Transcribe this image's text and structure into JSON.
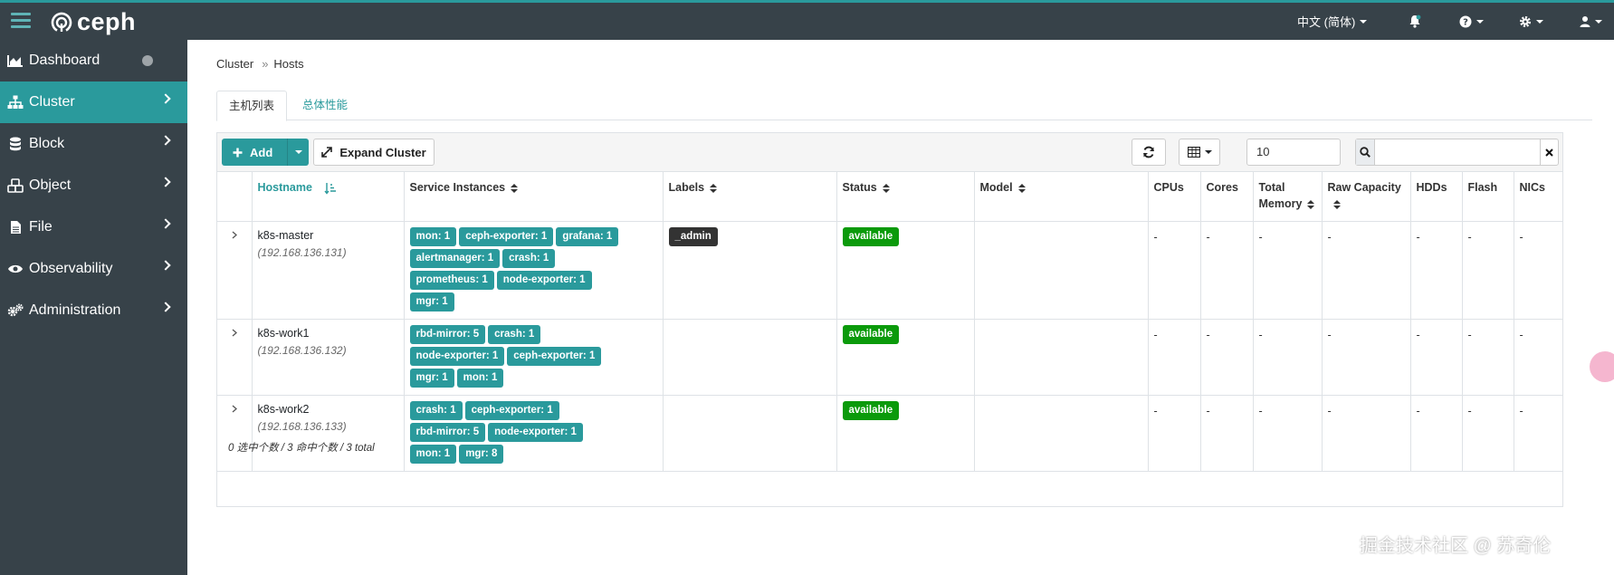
{
  "app": {
    "logo_text": "ceph"
  },
  "topbar": {
    "language": "中文 (简体)"
  },
  "sidebar": {
    "items": [
      {
        "label": "Dashboard"
      },
      {
        "label": "Cluster"
      },
      {
        "label": "Block"
      },
      {
        "label": "Object"
      },
      {
        "label": "File"
      },
      {
        "label": "Observability"
      },
      {
        "label": "Administration"
      }
    ]
  },
  "breadcrumb": {
    "parent": "Cluster",
    "current": "Hosts"
  },
  "tabs": [
    {
      "label": "主机列表"
    },
    {
      "label": "总体性能"
    }
  ],
  "toolbar": {
    "add_label": "Add",
    "expand_label": "Expand Cluster",
    "page_size": "10",
    "search_value": ""
  },
  "table": {
    "columns": [
      "Hostname",
      "Service Instances",
      "Labels",
      "Status",
      "Model",
      "CPUs",
      "Cores",
      "Total Memory",
      "Raw Capacity",
      "HDDs",
      "Flash",
      "NICs"
    ],
    "rows": [
      {
        "hostname": "k8s-master",
        "ip": "(192.168.136.131)",
        "services": [
          "mon: 1",
          "ceph-exporter: 1",
          "grafana: 1",
          "alertmanager: 1",
          "crash: 1",
          "prometheus: 1",
          "node-exporter: 1",
          "mgr: 1"
        ],
        "labels": [
          "_admin"
        ],
        "status": "available",
        "model": "",
        "cpus": "-",
        "cores": "-",
        "memory": "-",
        "raw": "-",
        "hdds": "-",
        "flash": "-",
        "nics": "-"
      },
      {
        "hostname": "k8s-work1",
        "ip": "(192.168.136.132)",
        "services": [
          "rbd-mirror: 5",
          "crash: 1",
          "node-exporter: 1",
          "ceph-exporter: 1",
          "mgr: 1",
          "mon: 1"
        ],
        "labels": [],
        "status": "available",
        "model": "",
        "cpus": "-",
        "cores": "-",
        "memory": "-",
        "raw": "-",
        "hdds": "-",
        "flash": "-",
        "nics": "-"
      },
      {
        "hostname": "k8s-work2",
        "ip": "(192.168.136.133)",
        "services": [
          "crash: 1",
          "ceph-exporter: 1",
          "rbd-mirror: 5",
          "node-exporter: 1",
          "mon: 1",
          "mgr: 8"
        ],
        "labels": [],
        "status": "available",
        "model": "",
        "cpus": "-",
        "cores": "-",
        "memory": "-",
        "raw": "-",
        "hdds": "-",
        "flash": "-",
        "nics": "-"
      }
    ]
  },
  "footer": {
    "summary": "0 选中个数 / 3 命中个数 / 3 total"
  },
  "watermark": "掘金技术社区 @ 苏奇伦",
  "colors": {
    "accent": "#2a9a9c",
    "navbar": "#374249",
    "status_green": "#0b9a0b"
  }
}
